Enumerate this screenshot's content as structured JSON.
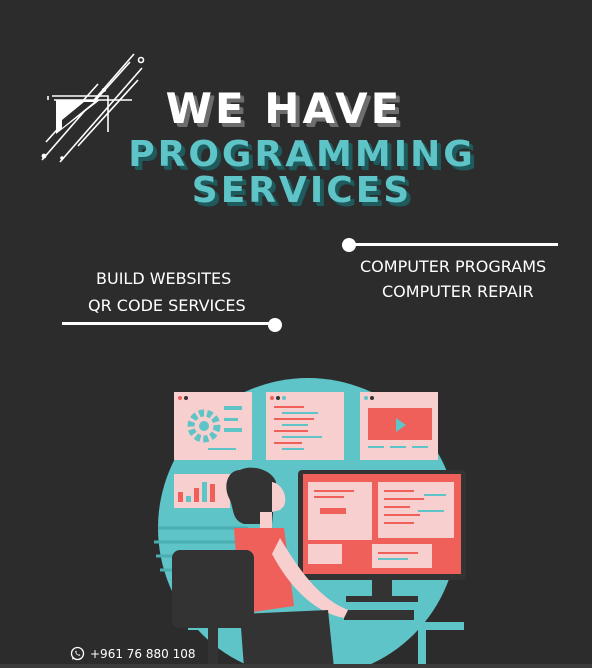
{
  "headline": {
    "line1": "WE HAVE",
    "line2": "PROGRAMMING",
    "line3": "SERVICES"
  },
  "services_left": [
    "BUILD WEBSITES",
    "QR CODE SERVICES"
  ],
  "services_right": [
    "COMPUTER PROGRAMS",
    "COMPUTER REPAIR"
  ],
  "contact": {
    "phone": "+961 76 880 108",
    "icon": "whatsapp-icon"
  },
  "colors": {
    "background": "#2c2c2c",
    "accent_teal": "#5ec4c8",
    "accent_coral": "#f0605a",
    "panel_pink": "#f7cfcf"
  }
}
